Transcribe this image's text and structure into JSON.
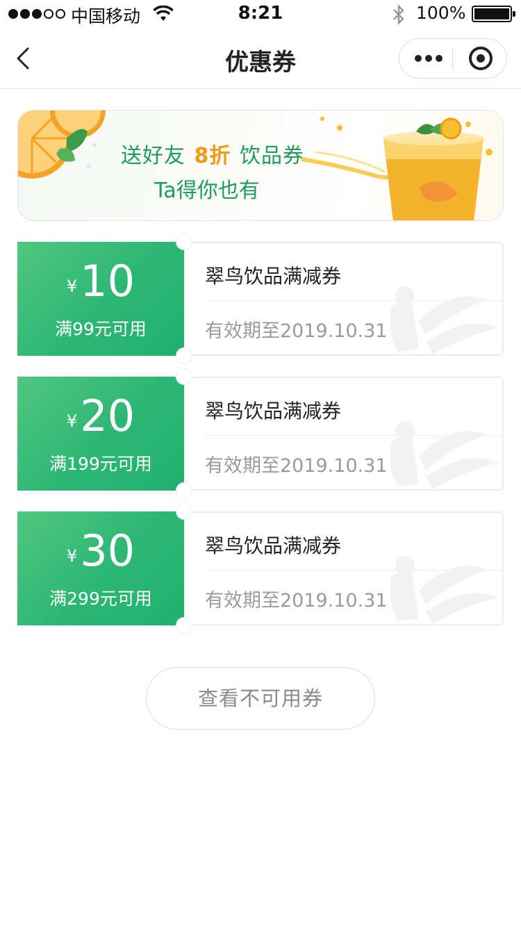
{
  "status_bar": {
    "carrier": "中国移动",
    "time": "8:21",
    "battery": "100%"
  },
  "nav": {
    "title": "优惠券"
  },
  "banner": {
    "line1_before": "送好友",
    "discount": "8折",
    "line1_after": "饮品券",
    "line2": "Ta得你也有"
  },
  "coupons": [
    {
      "currency": "¥",
      "amount": "10",
      "condition": "满99元可用",
      "name": "翠鸟饮品满减券",
      "expiry": "有效期至2019.10.31"
    },
    {
      "currency": "¥",
      "amount": "20",
      "condition": "满199元可用",
      "name": "翠鸟饮品满减券",
      "expiry": "有效期至2019.10.31"
    },
    {
      "currency": "¥",
      "amount": "30",
      "condition": "满299元可用",
      "name": "翠鸟饮品满减券",
      "expiry": "有效期至2019.10.31"
    }
  ],
  "footer": {
    "view_unusable_label": "查看不可用券"
  },
  "colors": {
    "coupon_green": "#2cb673",
    "banner_text": "#1f9a5c",
    "discount_orange": "#f09a14"
  }
}
